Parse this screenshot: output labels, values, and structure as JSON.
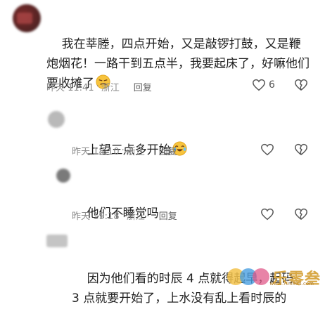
{
  "comments": [
    {
      "text": "我在莘塍，四点开始，又是敲锣打鼓，又是鞭炮烟花！一路干到五点半，我要起床了，好嘛他们要收摊了",
      "time": "昨天 11:41",
      "location": "浙江",
      "reply_label": "回复",
      "like_count": "6"
    },
    {
      "text": "上望三点多开始",
      "time": "昨天 18:10",
      "location": "浙江",
      "reply_label": "回复"
    },
    {
      "text": "他们不睡觉吗",
      "time": "昨天 19:18",
      "location": "浙江",
      "reply_label": "回复"
    },
    {
      "text": "因为他们看的时辰 4 点就得起早，起码 3 点就要开始了，上水没有乱上看时辰的"
    }
  ],
  "watermark": {
    "text": "乐零叁",
    "url": "www.703804.com"
  },
  "colors": {
    "meta_text": "#8c8c8c",
    "body_text": "#1f1f1f",
    "watermark": "#d8a845"
  },
  "icons": [
    "heart-outline-icon",
    "heart-broken-icon",
    "emoji-smirk-icon",
    "emoji-laugh-cry-icon"
  ]
}
